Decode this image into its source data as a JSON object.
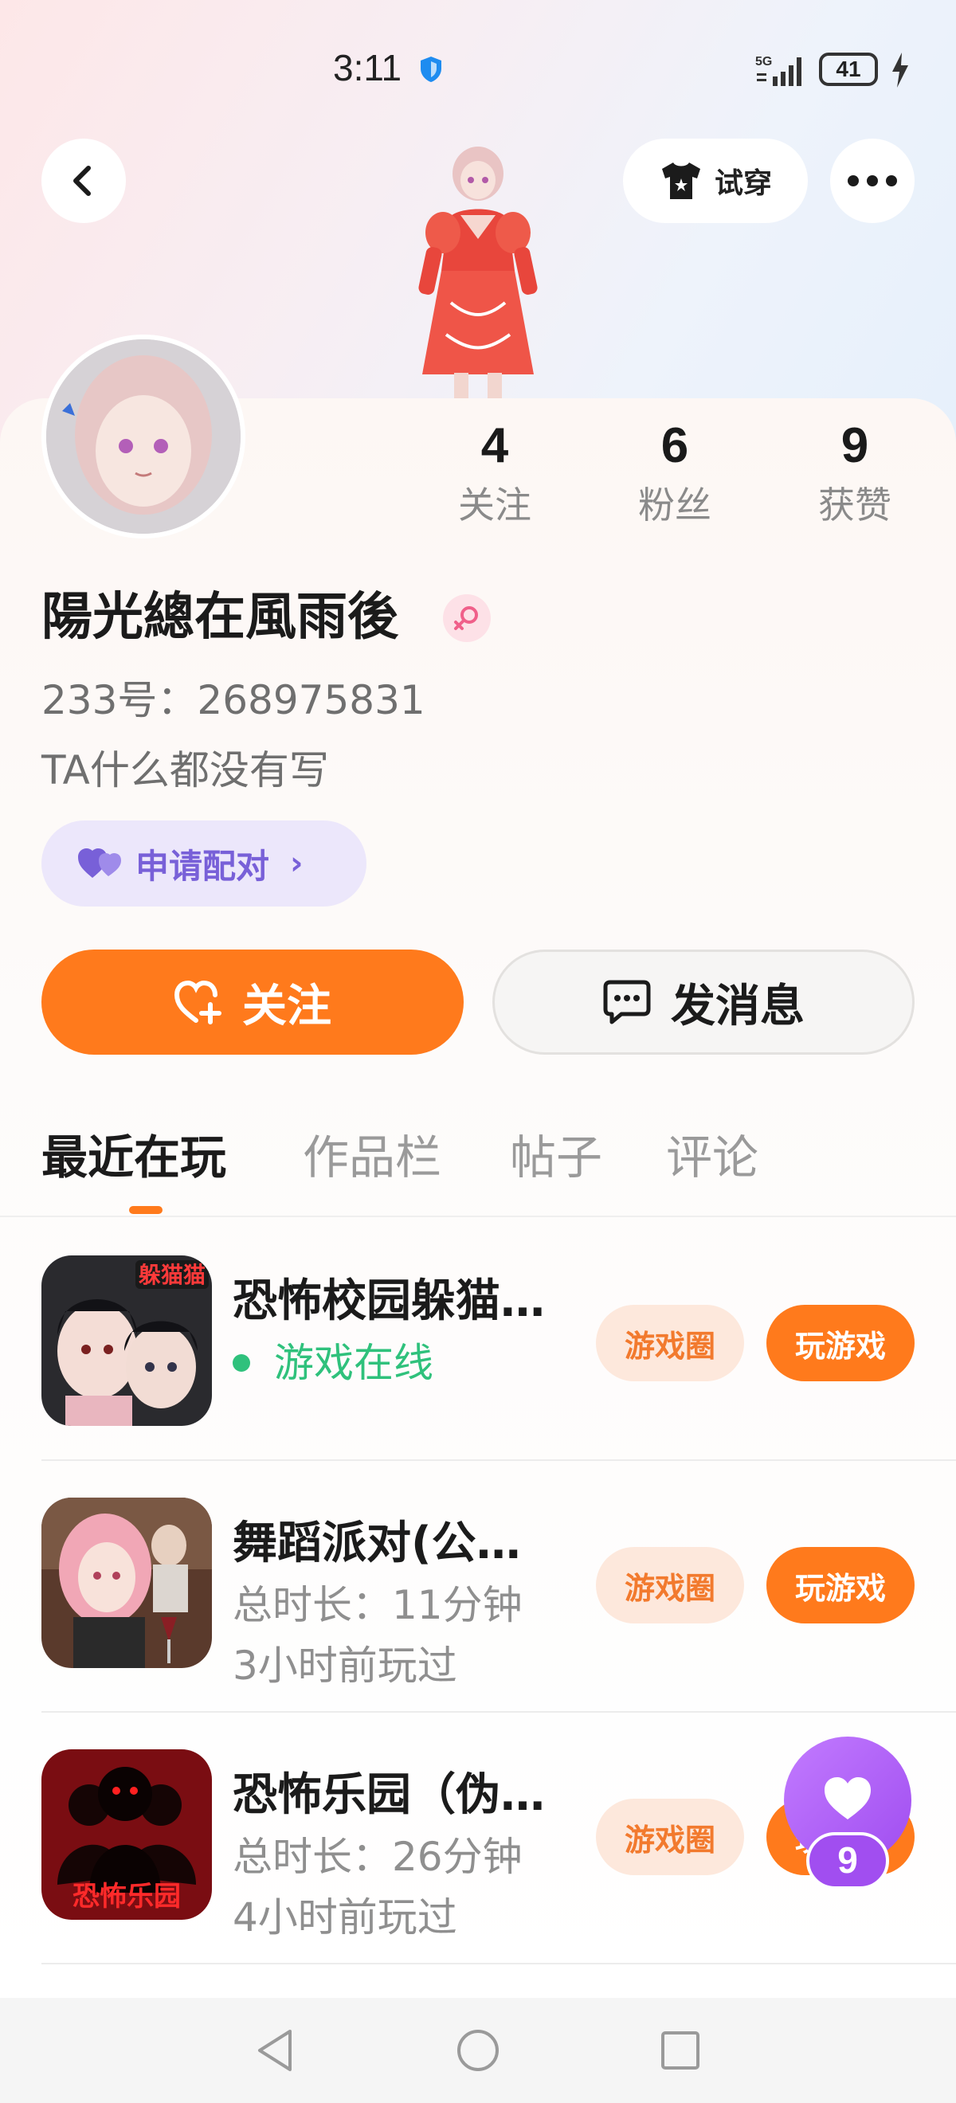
{
  "status_bar": {
    "time": "3:11",
    "network": "5G",
    "battery": "41"
  },
  "header": {
    "back_icon": "back-arrow-icon",
    "try_on_label": "试穿",
    "more_icon": "more-dots-icon"
  },
  "profile": {
    "stats": [
      {
        "value": "4",
        "label": "关注"
      },
      {
        "value": "6",
        "label": "粉丝"
      },
      {
        "value": "9",
        "label": "获赞"
      }
    ],
    "username": "陽光總在風雨後",
    "gender": "female",
    "id_text": "233号：268975831",
    "bio": "TA什么都没有写",
    "pair_label": "申请配对",
    "follow_label": "关注",
    "message_label": "发消息"
  },
  "tabs": [
    {
      "label": "最近在玩",
      "active": true
    },
    {
      "label": "作品栏",
      "active": false
    },
    {
      "label": "帖子",
      "active": false
    },
    {
      "label": "评论",
      "active": false
    }
  ],
  "games": [
    {
      "title": "恐怖校园躲猫…",
      "line1": "游戏在线",
      "line2": "",
      "online": true,
      "circle_label": "游戏圈",
      "play_label": "玩游戏",
      "icon_text": "躲猫猫"
    },
    {
      "title": "舞蹈派对(公…",
      "line1": "总时长：11分钟",
      "line2": "3小时前玩过",
      "online": false,
      "circle_label": "游戏圈",
      "play_label": "玩游戏",
      "icon_text": ""
    },
    {
      "title": "恐怖乐园（伪…",
      "line1": "总时长：26分钟",
      "line2": "4小时前玩过",
      "online": false,
      "circle_label": "游戏圈",
      "play_label": "玩游戏",
      "icon_text": "恐怖乐园"
    }
  ],
  "floating_like": {
    "count": "9"
  },
  "colors": {
    "accent_orange": "#ff7a1c",
    "pair_purple": "#7860d8",
    "online_green": "#2fc17c",
    "like_purple": "#a04df0"
  }
}
